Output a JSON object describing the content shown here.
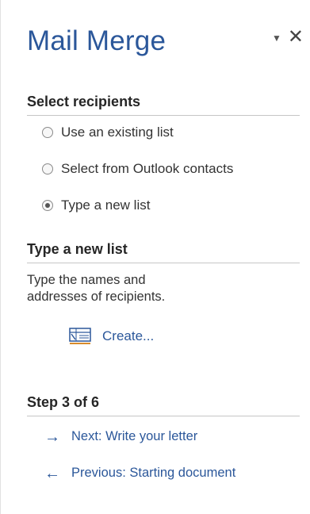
{
  "pane": {
    "title": "Mail Merge",
    "accent_color": "#2b579a"
  },
  "select_recipients": {
    "heading": "Select recipients",
    "options": [
      {
        "label": "Use an existing list",
        "selected": false
      },
      {
        "label": "Select from Outlook contacts",
        "selected": false
      },
      {
        "label": "Type a new list",
        "selected": true
      }
    ]
  },
  "type_new_list": {
    "heading": "Type a new list",
    "description_line1": "Type the names and",
    "description_line2": "addresses of recipients.",
    "create_label": "Create...",
    "create_icon": "new-list-icon"
  },
  "step": {
    "heading": "Step 3 of 6",
    "next_label": "Next: Write your letter",
    "previous_label": "Previous: Starting document"
  }
}
